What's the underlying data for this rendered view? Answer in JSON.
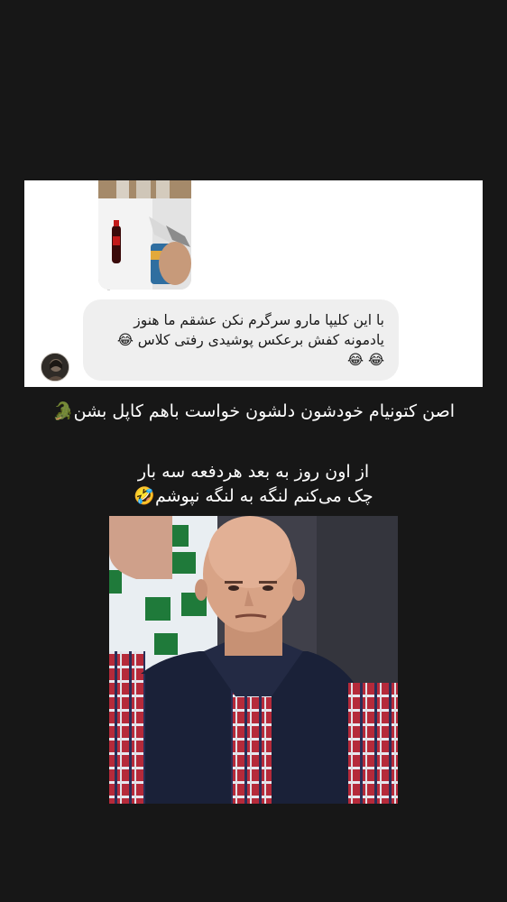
{
  "card": {
    "message_line1": "با این کلیپا مارو سرگرم نکن عشقم ما هنوز",
    "message_line2": "یادمونه کفش برعکس پوشیدی رفتی کلاس 😂",
    "message_line3": "😂 😂"
  },
  "captions": {
    "line1": "اصن کتونیام خودشون دلشون خواست باهم کاپل بشن🐊",
    "line2": "از اون روز به بعد هردفعه سه بار",
    "line3": "چک می‌کنم لنگه به لنگه نپوشم🤣"
  },
  "icons": {
    "avatar": "user-avatar",
    "thumbnail": "video-thumbnail",
    "meme": "disappointed-fan-photo"
  },
  "colors": {
    "background": "#171717",
    "card": "#ffffff",
    "bubble": "#efefef",
    "text_light": "#ffffff",
    "text_dark": "#1a1a1a"
  }
}
